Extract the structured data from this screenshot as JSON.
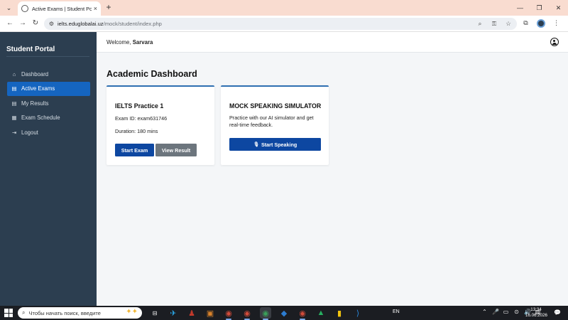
{
  "browser": {
    "tab_title": "Active Exams | Student Portal",
    "url_host": "ielts.eduglobalai.uz",
    "url_path": "/mock/student/index.php",
    "icons": {
      "tab_menu": "⌄",
      "favicon": "globe-icon",
      "tab_close": "×",
      "new_tab": "+",
      "minimize": "—",
      "restore": "❐",
      "close": "✕",
      "back": "←",
      "forward": "→",
      "reload": "↻",
      "site_info": "⚙",
      "zoom": "⌕",
      "password": "⚿",
      "bookmark": "☆",
      "extensions": "⧉",
      "menu": "⋮"
    }
  },
  "sidebar": {
    "brand": "Student Portal",
    "items": [
      {
        "label": "Dashboard",
        "icon": "⌂",
        "active": false
      },
      {
        "label": "Active Exams",
        "icon": "▤",
        "active": true
      },
      {
        "label": "My Results",
        "icon": "▤",
        "active": false
      },
      {
        "label": "Exam Schedule",
        "icon": "▦",
        "active": false
      },
      {
        "label": "Logout",
        "icon": "⇥",
        "active": false
      }
    ]
  },
  "header": {
    "welcome_prefix": "Welcome,",
    "username": "Sarvara"
  },
  "main": {
    "title": "Academic Dashboard",
    "exam_card": {
      "title": "IELTS Practice 1",
      "exam_id": "Exam ID: exam631746",
      "duration": "Duration: 180 mins",
      "start_label": "Start Exam",
      "view_label": "View Result"
    },
    "speaking_card": {
      "title": "MOCK SPEAKING SIMULATOR",
      "description": "Practice with our AI simulator and get real-time feedback.",
      "mic_icon": "🎙",
      "button_label": "Start Speaking"
    }
  },
  "taskbar": {
    "search_placeholder": "Чтобы начать поиск, введите",
    "language": "EN",
    "time": "13:34",
    "date": "16.06.2026",
    "search_icon": "⌕",
    "search_art": "✦✦",
    "task_view": "⊟",
    "tray": [
      "⌃",
      "🎤",
      "▭",
      "⊙",
      "🔊",
      "▥"
    ],
    "notification": "💬",
    "apps": [
      {
        "name": "telegram",
        "glyph": "✈",
        "color": "#2aabee",
        "active": false
      },
      {
        "name": "app-2",
        "glyph": "♟",
        "color": "#c0392b",
        "active": false
      },
      {
        "name": "app-3",
        "glyph": "▣",
        "color": "#d9822b",
        "active": false
      },
      {
        "name": "chrome-1",
        "glyph": "◉",
        "color": "#d14b3a",
        "active": true
      },
      {
        "name": "chrome-2",
        "glyph": "◉",
        "color": "#d14b3a",
        "active": true
      },
      {
        "name": "chrome-3",
        "glyph": "◉",
        "color": "#3aa15a",
        "active": true
      },
      {
        "name": "app-7",
        "glyph": "◆",
        "color": "#2d7dd2",
        "active": false
      },
      {
        "name": "chrome-4",
        "glyph": "◉",
        "color": "#d14b3a",
        "active": true
      },
      {
        "name": "app-9",
        "glyph": "▲",
        "color": "#27ae60",
        "active": false
      },
      {
        "name": "file-explorer",
        "glyph": "▮",
        "color": "#f1c40f",
        "active": false
      },
      {
        "name": "vscode",
        "glyph": "⟩",
        "color": "#2b8be0",
        "active": false
      }
    ]
  }
}
